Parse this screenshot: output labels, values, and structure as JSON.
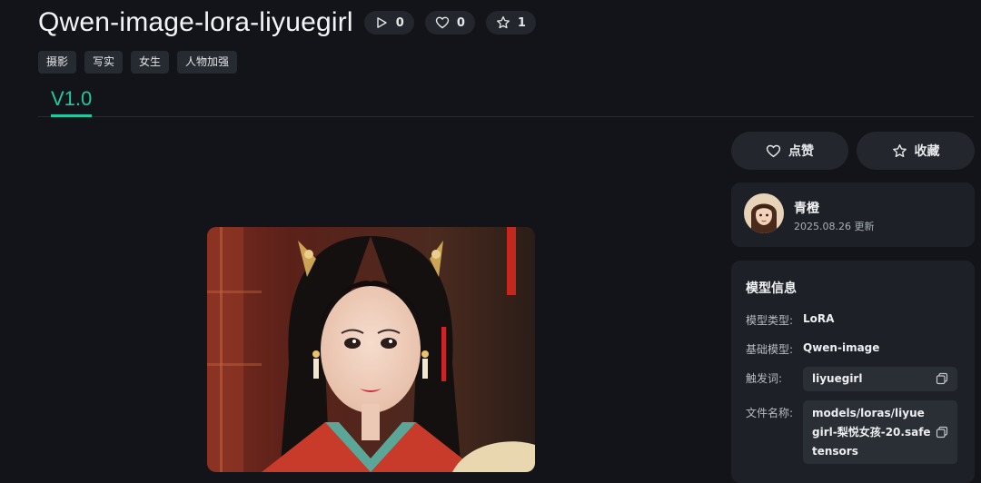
{
  "model": {
    "title": "Qwen-image-lora-liyuegirl",
    "stats": {
      "plays": "0",
      "likes": "0",
      "favorites": "1"
    },
    "tags": [
      "摄影",
      "写实",
      "女生",
      "人物加强"
    ],
    "versions": [
      "V1.0"
    ]
  },
  "actions": {
    "like_label": "点赞",
    "favorite_label": "收藏"
  },
  "author": {
    "name": "青橙",
    "updated": "2025.08.26 更新"
  },
  "info": {
    "heading": "模型信息",
    "type_label": "模型类型:",
    "type_value": "LoRA",
    "base_label": "基础模型:",
    "base_value": "Qwen-image",
    "trigger_label": "触发词:",
    "trigger_value": "liyuegirl",
    "file_label": "文件名称:",
    "file_value": "models/loras/liyuegirl-梨悦女孩-20.safetensors"
  },
  "colors": {
    "accent": "#22c7a0",
    "background": "#121419",
    "card": "#1d2026"
  }
}
